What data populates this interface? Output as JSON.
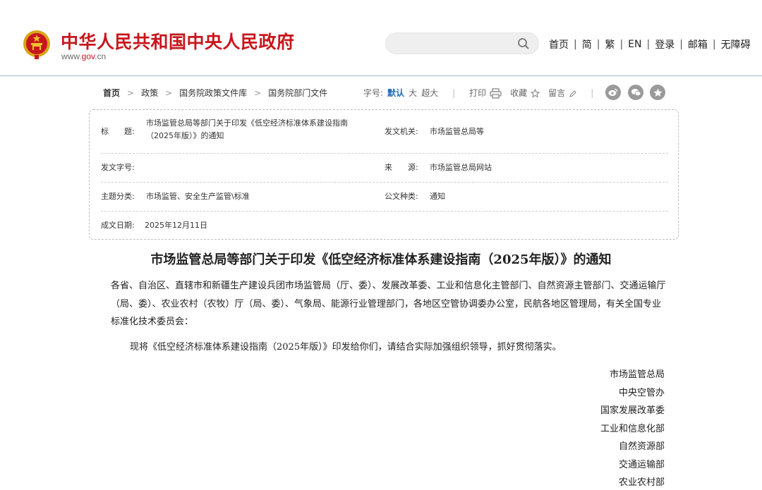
{
  "header": {
    "site_title": "中华人民共和国中央人民政府",
    "site_url_prefix": "www.",
    "site_url_mid": "gov",
    "site_url_suffix": ".cn",
    "search_placeholder": "",
    "nav": [
      "首页",
      "简",
      "繁",
      "EN",
      "登录",
      "邮箱",
      "无障碍"
    ],
    "nav_separator": "|"
  },
  "breadcrumb": {
    "items": [
      "首页",
      "政策",
      "国务院政策文件库",
      "国务院部门文件"
    ],
    "arrow": ">"
  },
  "tools": {
    "font_size_label": "字号:",
    "font_default": "默认",
    "font_large": "大",
    "font_xlarge": "超大",
    "separator": "|",
    "print": "打印",
    "favorite": "收藏",
    "comment": "留言"
  },
  "share_icons": [
    "weibo-icon",
    "wechat-icon",
    "qzone-icon"
  ],
  "info": {
    "title_label": "标　　题:",
    "title_value_line1": "市场监管总局等部门关于印发《低空经济标准体系建设指南",
    "title_value_line2": "（2025年版）》的通知",
    "issuer_label": "发文机关:",
    "issuer_value": "市场监管总局等",
    "doc_no_label": "发文字号:",
    "doc_no_value": "",
    "source_label": "来　　源:",
    "source_value": "市场监管总局网站",
    "topic_label": "主题分类:",
    "topic_value": "市场监管、安全生产监管\\标准",
    "type_label": "公文种类:",
    "type_value": "通知",
    "date_label": "成文日期:",
    "date_value": "2025年12月11日"
  },
  "article": {
    "title": "市场监管总局等部门关于印发《低空经济标准体系建设指南（2025年版）》的通知",
    "addressees": "各省、自治区、直辖市和新疆生产建设兵团市场监管局（厅、委）、发展改革委、工业和信息化主管部门、自然资源主管部门、交通运输厅（局、委）、农业农村（农牧）厅（局、委）、气象局、能源行业管理部门，各地区空管协调委办公室，民航各地区管理局，有关全国专业标准化技术委员会：",
    "body": "现将《低空经济标准体系建设指南（2025年版）》印发给你们，请结合实际加强组织领导，抓好贯彻落实。",
    "signers": [
      "市场监管总局",
      "中央空管办",
      "国家发展改革委",
      "工业和信息化部",
      "自然资源部",
      "交通运输部",
      "农业农村部"
    ]
  },
  "colors": {
    "brand_red": "#c8161d",
    "link_blue": "#1f6bb0",
    "header_border": "#9cb6c9"
  }
}
